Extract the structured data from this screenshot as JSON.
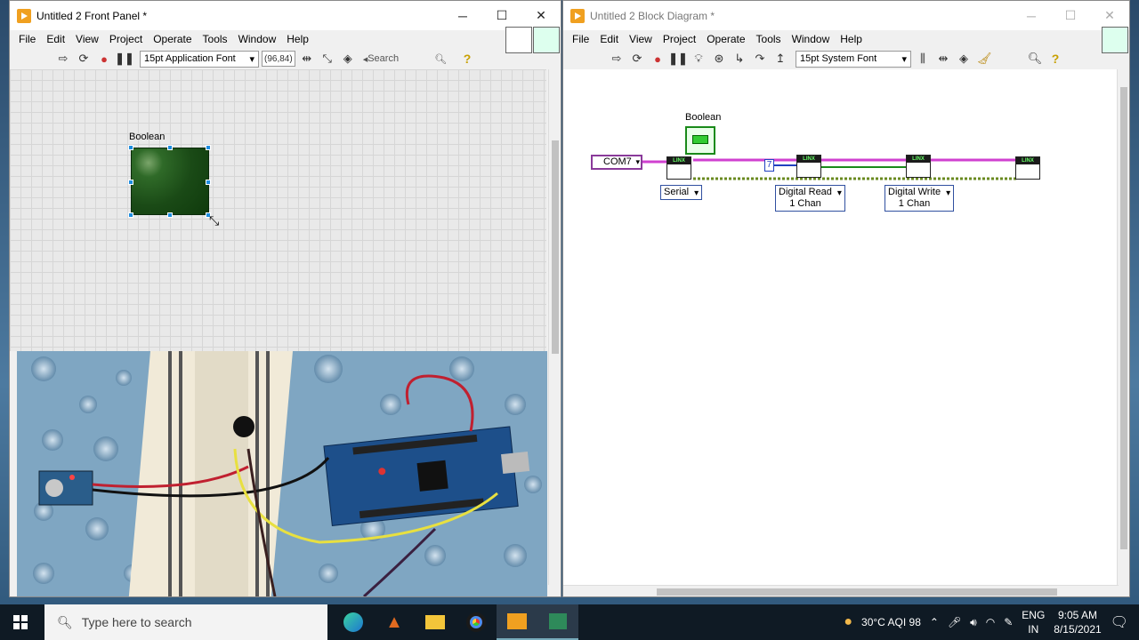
{
  "front_panel": {
    "title": "Untitled 2 Front Panel *",
    "menu": [
      "File",
      "Edit",
      "View",
      "Project",
      "Operate",
      "Tools",
      "Window",
      "Help"
    ],
    "font": "15pt Application Font",
    "coords": "(96,84)",
    "search_placeholder": "Search",
    "boolean_label": "Boolean"
  },
  "block_diagram": {
    "title": "Untitled 2 Block Diagram *",
    "menu": [
      "File",
      "Edit",
      "View",
      "Project",
      "Operate",
      "Tools",
      "Window",
      "Help"
    ],
    "font": "15pt System Font",
    "boolean_label": "Boolean",
    "com_port": "COM7",
    "constant": "7",
    "serial_label": "Serial",
    "read_label_1": "Digital Read",
    "read_label_2": "1 Chan",
    "write_label_1": "Digital Write",
    "write_label_2": "1 Chan",
    "linx_tag": "LINX"
  },
  "taskbar": {
    "search_placeholder": "Type here to search",
    "weather": "30°C  AQI 98",
    "lang_1": "ENG",
    "lang_2": "IN",
    "time": "9:05 AM",
    "date": "8/15/2021"
  },
  "colors": {
    "labview_orange": "#f0a020",
    "wire_pink": "#d040d0",
    "wire_green": "#6a8a20",
    "led_green": "#1a4a16"
  }
}
